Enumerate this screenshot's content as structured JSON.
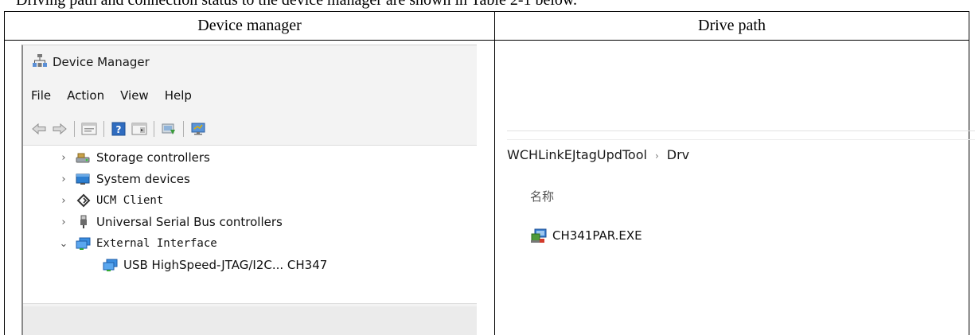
{
  "page_caption": "Driving path and connection status to the device manager are shown in Table 2-1 below.",
  "table": {
    "headers": [
      "Device manager",
      "Drive path"
    ]
  },
  "device_manager": {
    "title": "Device Manager",
    "menu": [
      "File",
      "Action",
      "View",
      "Help"
    ],
    "toolbar_icons": [
      "back-icon",
      "forward-icon",
      "properties-icon",
      "help-icon",
      "details-icon",
      "update-driver-icon",
      "monitor-icon"
    ],
    "tree": [
      {
        "label": "Storage controllers",
        "expanded": false,
        "icon": "storage-controller-icon"
      },
      {
        "label": "System devices",
        "expanded": false,
        "icon": "system-devices-icon"
      },
      {
        "label": "UCM Client",
        "expanded": false,
        "icon": "ucm-client-icon"
      },
      {
        "label": "Universal Serial Bus controllers",
        "expanded": false,
        "icon": "usb-icon"
      },
      {
        "label": "External Interface",
        "expanded": true,
        "icon": "external-interface-icon"
      },
      {
        "label": "USB HighSpeed-JTAG/I2C... CH347",
        "child": true,
        "icon": "interface-device-icon"
      }
    ],
    "colors": {
      "window_bg": "#f3f3f3",
      "tree_bg": "#ffffff",
      "accent": "#1e88d6"
    }
  },
  "explorer": {
    "breadcrumb": [
      "WCHLinkEJtagUpdTool",
      "Drv"
    ],
    "breadcrumb_separator": "›",
    "column_header": "名称",
    "files": [
      {
        "name": "CH341PAR.EXE",
        "icon": "installer-exe-icon"
      }
    ]
  }
}
